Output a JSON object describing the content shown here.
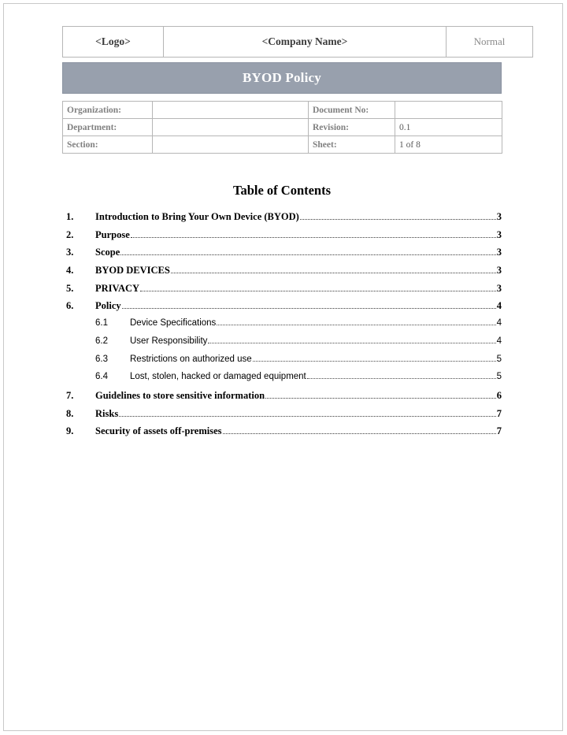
{
  "page": {
    "header_row": {
      "logo": "<Logo>",
      "company": "<Company Name>",
      "status": "Normal"
    },
    "title_band": {
      "title": "BYOD Policy",
      "background_color": "#98a0ad",
      "text_color": "#ffffff"
    },
    "meta_table": {
      "rows": [
        {
          "label_left": "Organization:",
          "value_left": "",
          "label_right": "Document No:",
          "value_right": ""
        },
        {
          "label_left": "Department:",
          "value_left": "",
          "label_right": "Revision:",
          "value_right": "0.1"
        },
        {
          "label_left": "Section:",
          "value_left": "",
          "label_right": "Sheet:",
          "value_right": "1 of 8"
        }
      ]
    },
    "toc": {
      "heading": "Table of Contents",
      "entries": [
        {
          "level": 1,
          "number": "1.",
          "title": "Introduction to Bring Your Own Device (BYOD)",
          "page": "3"
        },
        {
          "level": 1,
          "number": "2.",
          "title": "Purpose",
          "page": "3"
        },
        {
          "level": 1,
          "number": "3.",
          "title": "Scope",
          "page": "3"
        },
        {
          "level": 1,
          "number": "4.",
          "title": "BYOD DEVICES",
          "page": "3"
        },
        {
          "level": 1,
          "number": "5.",
          "title": "PRIVACY",
          "page": "3"
        },
        {
          "level": 1,
          "number": "6.",
          "title": "Policy",
          "page": "4"
        },
        {
          "level": 2,
          "number": "6.1",
          "title": "Device Specifications",
          "page": "4"
        },
        {
          "level": 2,
          "number": "6.2",
          "title": "User Responsibility",
          "page": "4"
        },
        {
          "level": 2,
          "number": "6.3",
          "title": "Restrictions on authorized use",
          "page": "5"
        },
        {
          "level": 2,
          "number": "6.4",
          "title": "Lost, stolen, hacked or damaged equipment",
          "page": "5"
        },
        {
          "level": 1,
          "number": "7.",
          "title": "Guidelines to store sensitive information",
          "page": "6"
        },
        {
          "level": 1,
          "number": "8.",
          "title": "Risks",
          "page": "7"
        },
        {
          "level": 1,
          "number": "9.",
          "title": "Security of assets off-premises",
          "page": "7"
        }
      ]
    }
  }
}
